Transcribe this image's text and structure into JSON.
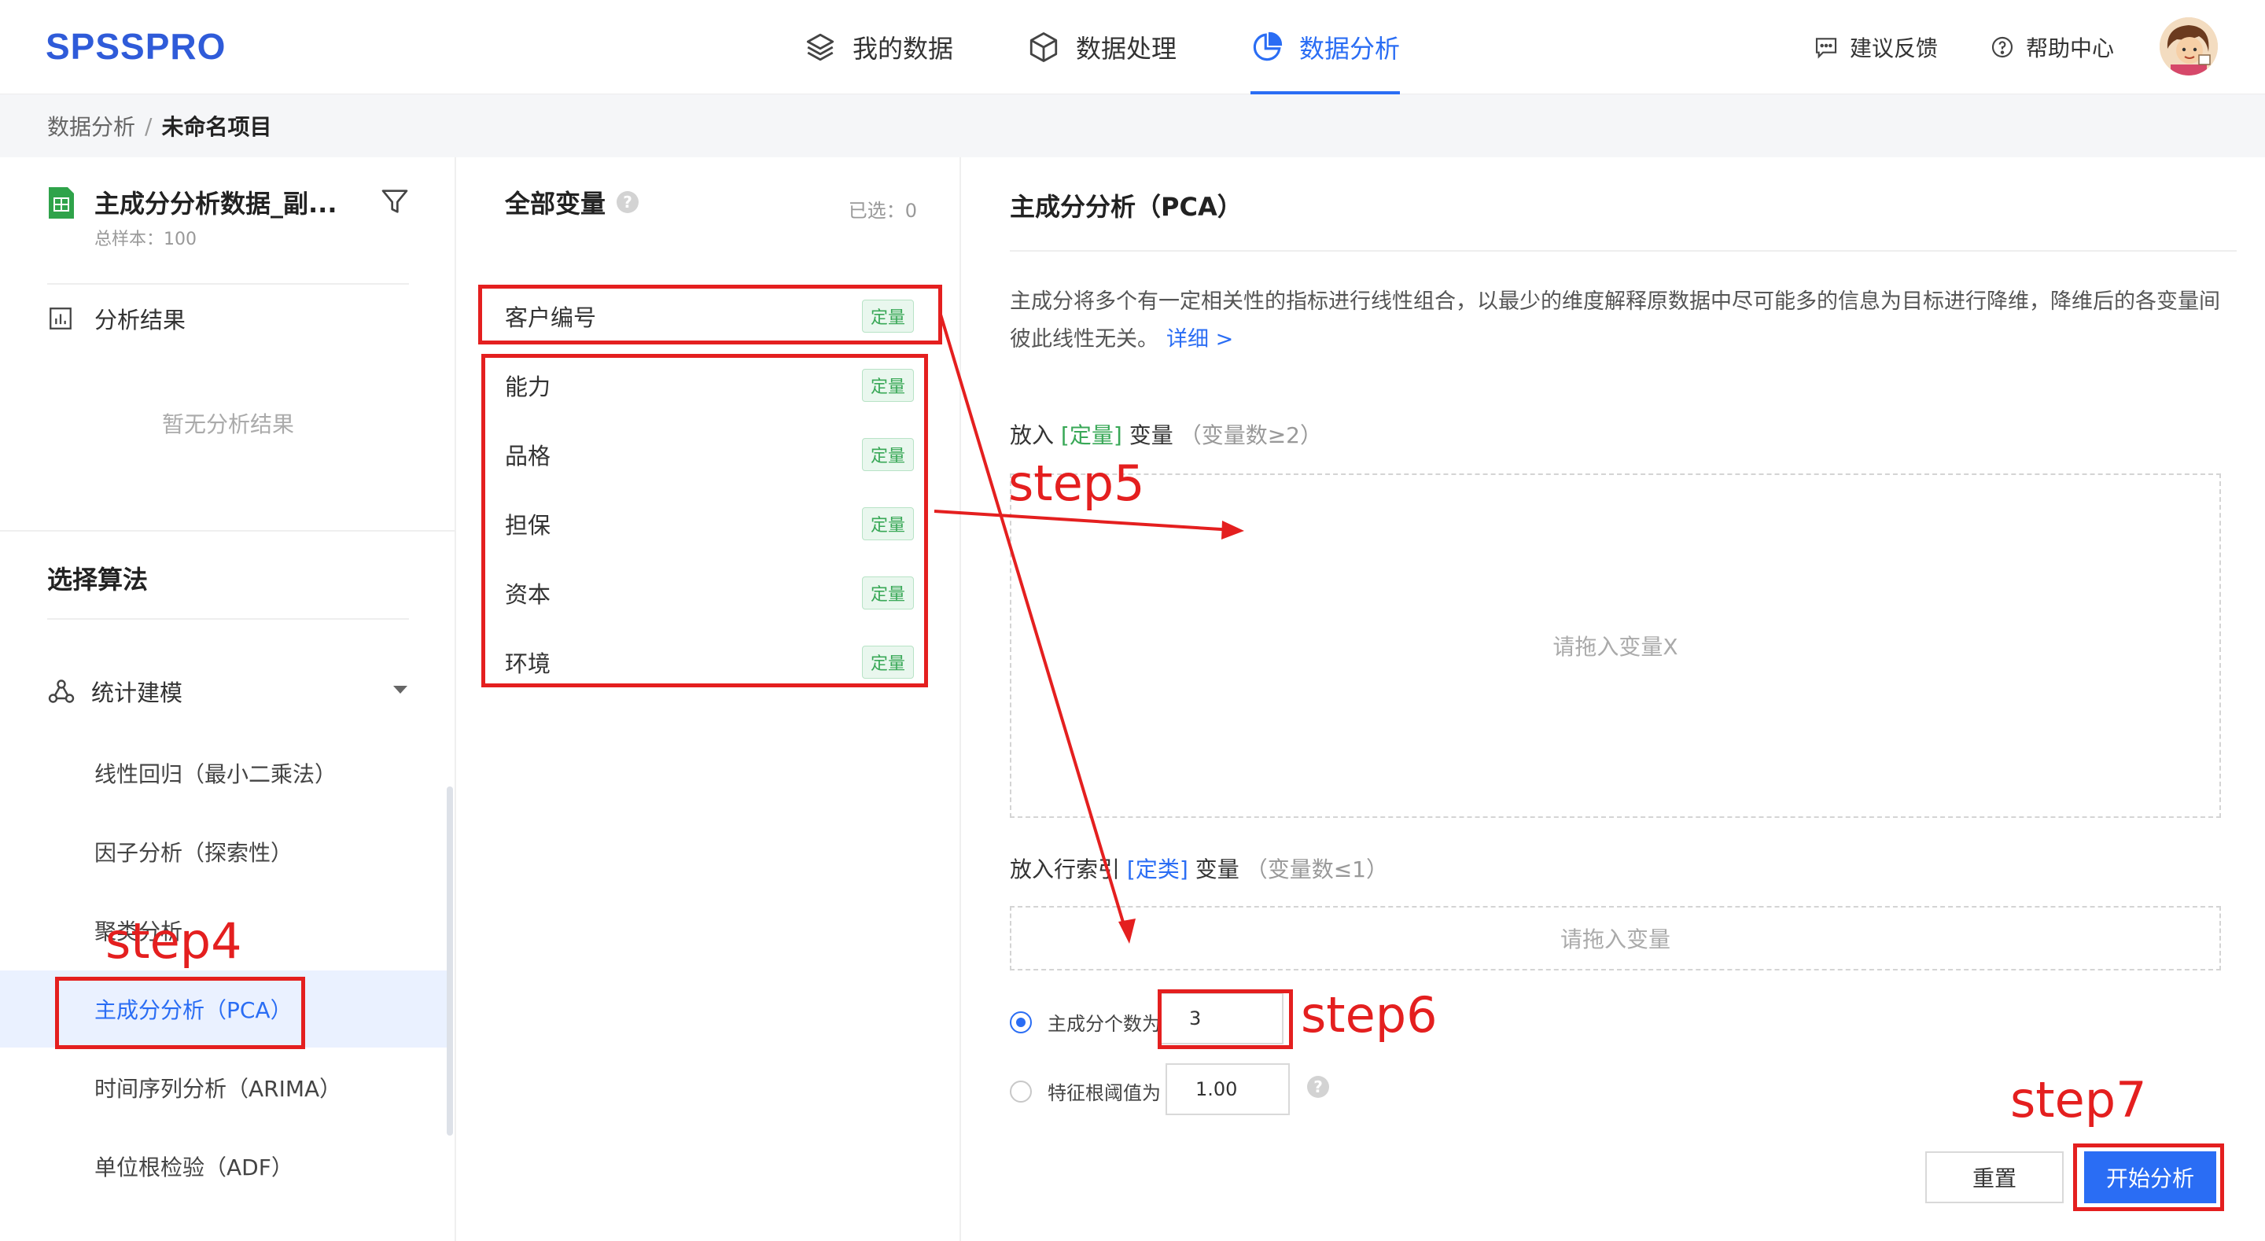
{
  "app": {
    "logo": "SPSSPRO",
    "nav": [
      {
        "label": "我的数据",
        "icon": "layers-icon",
        "active": false
      },
      {
        "label": "数据处理",
        "icon": "cube-icon",
        "active": false
      },
      {
        "label": "数据分析",
        "icon": "pie-chart-icon",
        "active": true
      }
    ],
    "feedback_label": "建议反馈",
    "help_label": "帮助中心"
  },
  "breadcrumb": {
    "parent": "数据分析",
    "separator": "/",
    "current": "未命名项目"
  },
  "sidebar": {
    "file_title": "主成分分析数据_副...",
    "file_sub": "总样本：100",
    "results_label": "分析结果",
    "no_results": "暂无分析结果",
    "algo_title": "选择算法",
    "group_label": "统计建模",
    "algorithms": [
      {
        "label": "线性回归（最小二乘法）",
        "selected": false
      },
      {
        "label": "因子分析（探索性）",
        "selected": false
      },
      {
        "label": "聚类分析",
        "selected": false
      },
      {
        "label": "主成分分析（PCA）",
        "selected": true
      },
      {
        "label": "时间序列分析（ARIMA）",
        "selected": false
      },
      {
        "label": "单位根检验（ADF）",
        "selected": false
      }
    ]
  },
  "variables": {
    "header": "全部变量",
    "selected_count": "已选：0",
    "items": [
      {
        "name": "客户编号",
        "tag": "定量"
      },
      {
        "name": "能力",
        "tag": "定量"
      },
      {
        "name": "品格",
        "tag": "定量"
      },
      {
        "name": "担保",
        "tag": "定量"
      },
      {
        "name": "资本",
        "tag": "定量"
      },
      {
        "name": "环境",
        "tag": "定量"
      }
    ]
  },
  "panel": {
    "title": "主成分分析（PCA）",
    "description": "主成分将多个有一定相关性的指标进行线性组合，以最少的维度解释原数据中尽可能多的信息为目标进行降维，降维后的各变量间彼此线性无关。",
    "more_link": "详细 >",
    "drop_x": {
      "prefix": "放入",
      "type": "[定量]",
      "suffix": "变量",
      "hint": "（变量数≥2）",
      "placeholder": "请拖入变量X"
    },
    "drop_index": {
      "prefix": "放入行索引",
      "type": "[定类]",
      "suffix": "变量",
      "hint": "（变量数≤1）",
      "placeholder": "请拖入变量"
    },
    "option_components": {
      "label": "主成分个数为",
      "value": "3",
      "selected": true
    },
    "option_eigen": {
      "label": "特征根阈值为",
      "value": "1.00",
      "selected": false
    },
    "reset_button": "重置",
    "start_button": "开始分析"
  },
  "annotations": {
    "step4": "step4",
    "step5": "step5",
    "step6": "step6",
    "step7": "step7",
    "color": "#e41f1f"
  },
  "colors": {
    "accent": "#2a6df4",
    "logo": "#2f5bd9",
    "tag_green": "#39a857"
  }
}
